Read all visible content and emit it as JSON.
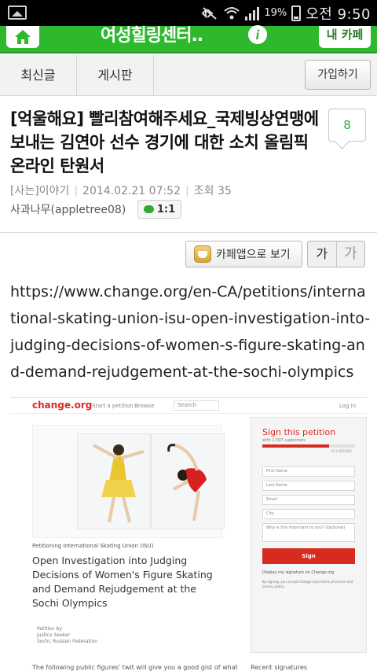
{
  "status_bar": {
    "battery": "19%",
    "time": "오전 9:50"
  },
  "top_bar": {
    "cafe_name": "여성힐링센터..",
    "info_icon": "i",
    "my_cafe_label": "내 카페"
  },
  "tabs": {
    "latest": "최신글",
    "board": "게시판",
    "join": "가입하기"
  },
  "post": {
    "title": "[억울해요] 빨리참여해주세요_국제빙상연맹에 보내는 김연아 선수 경기에 대한 소치 올림픽 온라인 탄원서",
    "comment_count": "8",
    "category": "[사는]이야기",
    "date": "2014.02.21 07:52",
    "views": "조회 35",
    "author": "사과나무(appletree08)",
    "chat_label": "1:1"
  },
  "toolbar": {
    "view_in_app": "카페앱으로 보기",
    "font_small": "가",
    "font_large": "가"
  },
  "body": {
    "url": "https://www.change.org/en-CA/petitions/international-skating-union-isu-open-investigation-into-judging-decisions-of-women-s-figure-skating-and-demand-rejudgement-at-the-sochi-olympics"
  },
  "embedded": {
    "logo": "change.org",
    "nav_start": "Start a petition",
    "nav_browse": "Browse",
    "search_placeholder": "Search",
    "login": "Log in",
    "petitioning": "Petitioning International Skating Union (ISU)",
    "petition_title": "Open Investigation into Judging Decisions of Women's Figure Skating and Demand Rejudgement at the Sochi Olympics",
    "petition_by_label": "Petition by",
    "petition_by_name": "Justice Seeker",
    "petition_by_place": "Sochi, Russian Federation",
    "footer_text": "The following public figures' twit will give you a good gist of what",
    "sign_title": "Sign this petition",
    "supporters": "with 1,597 supporters",
    "needed": "613 NEEDED",
    "signature_progress": 0.72,
    "fields": [
      "First Name",
      "Last Name",
      "Email",
      "City",
      "Why is this important to you? (Optional)"
    ],
    "sign_button": "Sign",
    "display_signature": "Display my signature on Change.org",
    "fine_print": "By signing, you accept Change.org's terms of service and privacy policy.",
    "recent_signatures": "Recent signatures"
  },
  "colors": {
    "brand_green": "#2eb82e",
    "change_red": "#d82b20"
  }
}
